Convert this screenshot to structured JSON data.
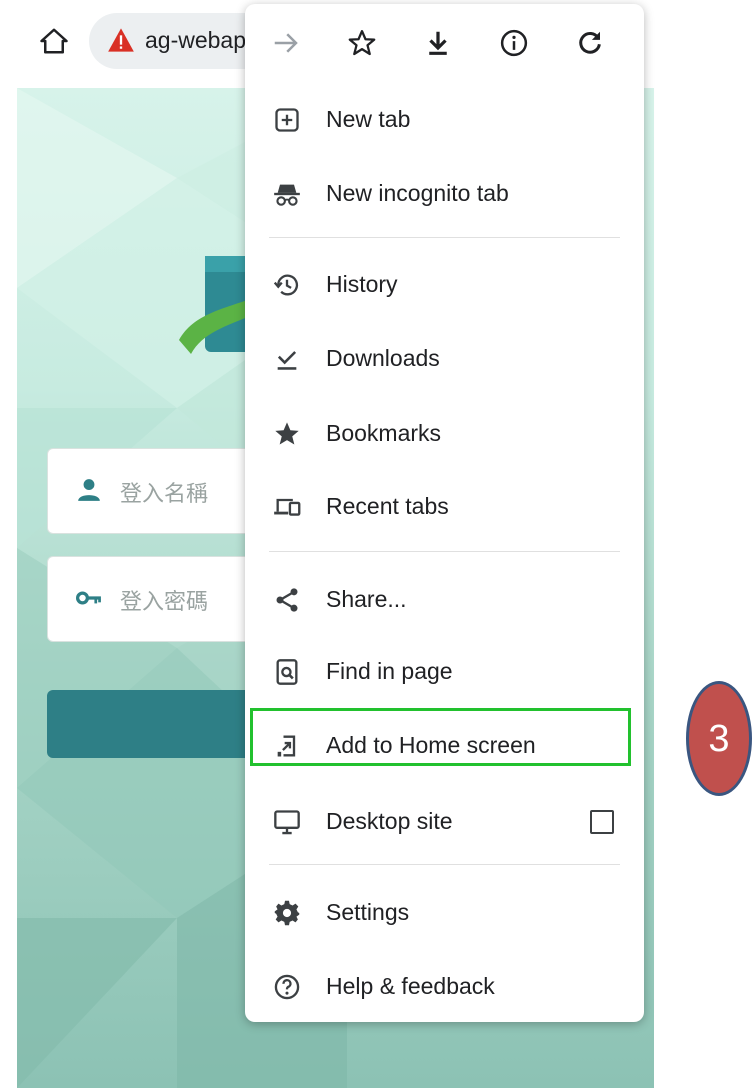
{
  "browser": {
    "url_text": "ag-webap",
    "icons": [
      "home-icon",
      "warning-icon"
    ]
  },
  "page": {
    "username_placeholder": "登入名稱",
    "password_placeholder": "登入密碼",
    "icons": [
      "user-icon",
      "key-icon"
    ],
    "accent_color": "#2e7f86"
  },
  "menu": {
    "toolbar_icons": [
      "forward-icon",
      "star-outline-icon",
      "download-icon",
      "info-icon",
      "refresh-icon"
    ],
    "items": [
      {
        "label": "New tab",
        "icon": "plus-box-icon"
      },
      {
        "label": "New incognito tab",
        "icon": "incognito-icon"
      },
      {
        "label": "History",
        "icon": "history-icon"
      },
      {
        "label": "Downloads",
        "icon": "downloads-icon"
      },
      {
        "label": "Bookmarks",
        "icon": "star-icon"
      },
      {
        "label": "Recent tabs",
        "icon": "devices-icon"
      },
      {
        "label": "Share...",
        "icon": "share-icon"
      },
      {
        "label": "Find in page",
        "icon": "find-in-page-icon"
      },
      {
        "label": "Add to Home screen",
        "icon": "add-to-home-icon"
      },
      {
        "label": "Desktop site",
        "icon": "desktop-icon",
        "checked": false
      },
      {
        "label": "Settings",
        "icon": "gear-icon"
      },
      {
        "label": "Help & feedback",
        "icon": "help-icon"
      }
    ]
  },
  "annotation": {
    "step_number": "3",
    "highlight_color": "#22c12e",
    "badge_color": "#c0504d"
  }
}
